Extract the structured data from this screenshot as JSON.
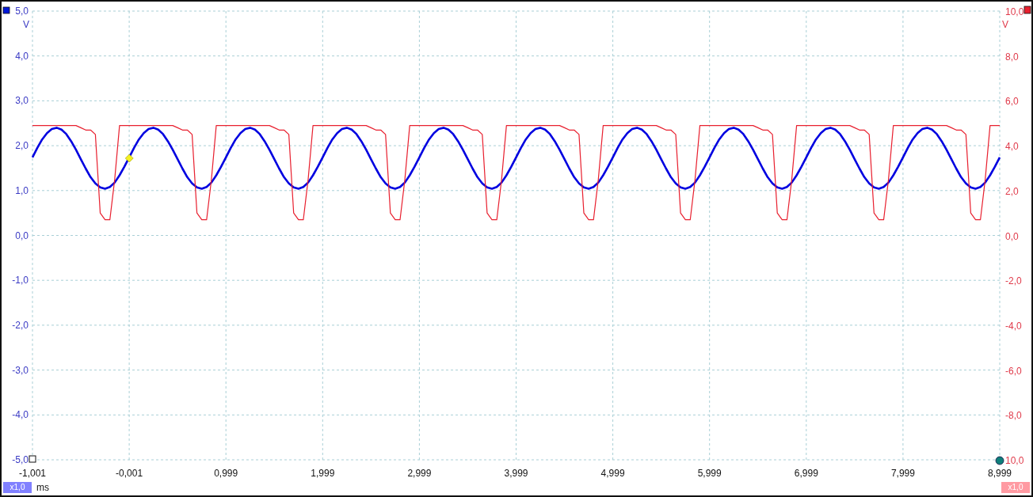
{
  "chart_data": {
    "type": "line",
    "grid": true,
    "xlabel": "ms",
    "ylabel": "V",
    "xlim": [
      -1.001,
      8.999
    ],
    "ylim": [
      -5,
      5
    ],
    "x": [
      -1.001,
      -0.951,
      -0.901,
      -0.851,
      -0.801,
      -0.751,
      -0.701,
      -0.651,
      -0.601,
      -0.551,
      -0.501,
      -0.451,
      -0.401,
      -0.351,
      -0.301,
      -0.251,
      -0.201,
      -0.151,
      -0.101,
      -0.051,
      -0.001,
      0.049,
      0.099,
      0.149,
      0.199,
      0.249,
      0.299,
      0.349,
      0.399,
      0.449,
      0.499,
      0.549,
      0.599,
      0.649,
      0.699,
      0.749,
      0.799,
      0.849,
      0.899,
      0.949,
      0.999,
      1.049,
      1.099,
      1.149,
      1.199,
      1.249,
      1.299,
      1.349,
      1.399,
      1.449,
      1.499,
      1.549,
      1.599,
      1.649,
      1.699,
      1.749,
      1.799,
      1.849,
      1.899,
      1.949,
      1.999,
      2.049,
      2.099,
      2.149,
      2.199,
      2.249,
      2.299,
      2.349,
      2.399,
      2.449,
      2.499,
      2.549,
      2.599,
      2.649,
      2.699,
      2.749,
      2.799,
      2.849,
      2.899,
      2.949,
      2.999,
      3.049,
      3.099,
      3.149,
      3.199,
      3.249,
      3.299,
      3.349,
      3.399,
      3.449,
      3.499,
      3.549,
      3.599,
      3.649,
      3.699,
      3.749,
      3.799,
      3.849,
      3.899,
      3.949,
      3.999,
      4.049,
      4.099,
      4.149,
      4.199,
      4.249,
      4.299,
      4.349,
      4.399,
      4.449,
      4.499,
      4.549,
      4.599,
      4.649,
      4.699,
      4.749,
      4.799,
      4.849,
      4.899,
      4.949,
      4.999,
      5.049,
      5.099,
      5.149,
      5.199,
      5.249,
      5.299,
      5.349,
      5.399,
      5.449,
      5.499,
      5.549,
      5.599,
      5.649,
      5.699,
      5.749,
      5.799,
      5.849,
      5.899,
      5.949,
      5.999,
      6.049,
      6.099,
      6.149,
      6.199,
      6.249,
      6.299,
      6.349,
      6.399,
      6.449,
      6.499,
      6.549,
      6.599,
      6.649,
      6.699,
      6.749,
      6.799,
      6.849,
      6.899,
      6.949,
      6.999,
      7.049,
      7.099,
      7.149,
      7.199,
      7.249,
      7.299,
      7.349,
      7.399,
      7.449,
      7.499,
      7.549,
      7.599,
      7.649,
      7.699,
      7.749,
      7.799,
      7.849,
      7.899,
      7.949,
      7.999,
      8.049,
      8.099,
      8.149,
      8.199,
      8.249,
      8.299,
      8.349,
      8.399,
      8.449,
      8.499,
      8.549,
      8.599,
      8.649,
      8.699,
      8.749,
      8.799,
      8.849,
      8.899,
      8.949,
      8.999
    ],
    "y2label": "V",
    "y2lim": [
      -10,
      10
    ],
    "y2ticks": [
      {
        "value": 10,
        "label": "10,0"
      },
      {
        "value": 8,
        "label": "8,0"
      },
      {
        "value": 6,
        "label": "6,0"
      },
      {
        "value": 4,
        "label": "4,0"
      },
      {
        "value": 2,
        "label": "2,0"
      },
      {
        "value": 0,
        "label": "0,0"
      },
      {
        "value": -2,
        "label": "-2,0"
      },
      {
        "value": -4,
        "label": "-4,0"
      },
      {
        "value": -6,
        "label": "-6,0"
      },
      {
        "value": -8,
        "label": "-8,0"
      },
      {
        "value": -10,
        "label": "10,0"
      }
    ],
    "xticks": [
      {
        "value": -1.001,
        "label": "-1,001"
      },
      {
        "value": -0.001,
        "label": "-0,001"
      },
      {
        "value": 0.999,
        "label": "0,999"
      },
      {
        "value": 1.999,
        "label": "1,999"
      },
      {
        "value": 2.999,
        "label": "2,999"
      },
      {
        "value": 3.999,
        "label": "3,999"
      },
      {
        "value": 4.999,
        "label": "4,999"
      },
      {
        "value": 5.999,
        "label": "5,999"
      },
      {
        "value": 6.999,
        "label": "6,999"
      },
      {
        "value": 7.999,
        "label": "7,999"
      },
      {
        "value": 8.999,
        "label": "8,999"
      }
    ],
    "yticks": [
      {
        "value": 5,
        "label": "5,0"
      },
      {
        "value": 4,
        "label": "4,0"
      },
      {
        "value": 3,
        "label": "3,0"
      },
      {
        "value": 2,
        "label": "2,0"
      },
      {
        "value": 1,
        "label": "1,0"
      },
      {
        "value": 0,
        "label": "0,0"
      },
      {
        "value": -1,
        "label": "-1,0"
      },
      {
        "value": -2,
        "label": "-2,0"
      },
      {
        "value": -3,
        "label": "-3,0"
      },
      {
        "value": -4,
        "label": "-4,0"
      },
      {
        "value": -5,
        "label": "-5,0"
      }
    ],
    "series": [
      {
        "color": "#0000e0",
        "values": [
          1.74,
          1.95,
          2.14,
          2.28,
          2.37,
          2.4,
          2.36,
          2.26,
          2.1,
          1.91,
          1.7,
          1.49,
          1.3,
          1.16,
          1.07,
          1.04,
          1.08,
          1.18,
          1.34,
          1.53,
          1.74,
          1.95,
          2.14,
          2.28,
          2.37,
          2.4,
          2.36,
          2.26,
          2.1,
          1.91,
          1.7,
          1.49,
          1.3,
          1.16,
          1.07,
          1.04,
          1.08,
          1.18,
          1.34,
          1.53,
          1.74,
          1.95,
          2.14,
          2.28,
          2.37,
          2.4,
          2.36,
          2.26,
          2.1,
          1.91,
          1.7,
          1.49,
          1.3,
          1.16,
          1.07,
          1.04,
          1.08,
          1.18,
          1.34,
          1.53,
          1.74,
          1.95,
          2.14,
          2.28,
          2.37,
          2.4,
          2.36,
          2.26,
          2.1,
          1.91,
          1.7,
          1.49,
          1.3,
          1.16,
          1.07,
          1.04,
          1.08,
          1.18,
          1.34,
          1.53,
          1.74,
          1.95,
          2.14,
          2.28,
          2.37,
          2.4,
          2.36,
          2.26,
          2.1,
          1.91,
          1.7,
          1.49,
          1.3,
          1.16,
          1.07,
          1.04,
          1.08,
          1.18,
          1.34,
          1.53,
          1.74,
          1.95,
          2.14,
          2.28,
          2.37,
          2.4,
          2.36,
          2.26,
          2.1,
          1.91,
          1.7,
          1.49,
          1.3,
          1.16,
          1.07,
          1.04,
          1.08,
          1.18,
          1.34,
          1.53,
          1.74,
          1.95,
          2.14,
          2.28,
          2.37,
          2.4,
          2.36,
          2.26,
          2.1,
          1.91,
          1.7,
          1.49,
          1.3,
          1.16,
          1.07,
          1.04,
          1.08,
          1.18,
          1.34,
          1.53,
          1.74,
          1.95,
          2.14,
          2.28,
          2.37,
          2.4,
          2.36,
          2.26,
          2.1,
          1.91,
          1.7,
          1.49,
          1.3,
          1.16,
          1.07,
          1.04,
          1.08,
          1.18,
          1.34,
          1.53,
          1.74,
          1.95,
          2.14,
          2.28,
          2.37,
          2.4,
          2.36,
          2.26,
          2.1,
          1.91,
          1.7,
          1.49,
          1.3,
          1.16,
          1.07,
          1.04,
          1.08,
          1.18,
          1.34,
          1.53,
          1.74,
          1.95,
          2.14,
          2.28,
          2.37,
          2.4,
          2.36,
          2.26,
          2.1,
          1.91,
          1.7,
          1.49,
          1.3,
          1.16,
          1.07,
          1.04,
          1.08,
          1.18,
          1.34,
          1.53,
          1.74
        ]
      },
      {
        "color": "#e8202f",
        "axis": "y2",
        "values": [
          4.9,
          4.9,
          4.9,
          4.9,
          4.9,
          4.9,
          4.9,
          4.9,
          4.9,
          4.9,
          4.8,
          4.7,
          4.7,
          4.5,
          1.0,
          0.7,
          0.7,
          2.5,
          4.9,
          4.9,
          4.9,
          4.9,
          4.9,
          4.9,
          4.9,
          4.9,
          4.9,
          4.9,
          4.9,
          4.9,
          4.8,
          4.7,
          4.7,
          4.5,
          1.0,
          0.7,
          0.7,
          2.5,
          4.9,
          4.9,
          4.9,
          4.9,
          4.9,
          4.9,
          4.9,
          4.9,
          4.9,
          4.9,
          4.9,
          4.9,
          4.8,
          4.7,
          4.7,
          4.5,
          1.0,
          0.7,
          0.7,
          2.5,
          4.9,
          4.9,
          4.9,
          4.9,
          4.9,
          4.9,
          4.9,
          4.9,
          4.9,
          4.9,
          4.9,
          4.9,
          4.8,
          4.7,
          4.7,
          4.5,
          1.0,
          0.7,
          0.7,
          2.5,
          4.9,
          4.9,
          4.9,
          4.9,
          4.9,
          4.9,
          4.9,
          4.9,
          4.9,
          4.9,
          4.9,
          4.9,
          4.8,
          4.7,
          4.7,
          4.5,
          1.0,
          0.7,
          0.7,
          2.5,
          4.9,
          4.9,
          4.9,
          4.9,
          4.9,
          4.9,
          4.9,
          4.9,
          4.9,
          4.9,
          4.9,
          4.9,
          4.8,
          4.7,
          4.7,
          4.5,
          1.0,
          0.7,
          0.7,
          2.5,
          4.9,
          4.9,
          4.9,
          4.9,
          4.9,
          4.9,
          4.9,
          4.9,
          4.9,
          4.9,
          4.9,
          4.9,
          4.8,
          4.7,
          4.7,
          4.5,
          1.0,
          0.7,
          0.7,
          2.5,
          4.9,
          4.9,
          4.9,
          4.9,
          4.9,
          4.9,
          4.9,
          4.9,
          4.9,
          4.9,
          4.9,
          4.9,
          4.8,
          4.7,
          4.7,
          4.5,
          1.0,
          0.7,
          0.7,
          2.5,
          4.9,
          4.9,
          4.9,
          4.9,
          4.9,
          4.9,
          4.9,
          4.9,
          4.9,
          4.9,
          4.9,
          4.9,
          4.8,
          4.7,
          4.7,
          4.5,
          1.0,
          0.7,
          0.7,
          2.5,
          4.9,
          4.9,
          4.9,
          4.9,
          4.9,
          4.9,
          4.9,
          4.9,
          4.9,
          4.9,
          4.9,
          4.9,
          4.8,
          4.7,
          4.7,
          4.5,
          1.0,
          0.7,
          0.7,
          2.5,
          4.9,
          4.9,
          4.9
        ]
      }
    ]
  },
  "left_scale": "x1,0",
  "right_scale": "x1,0"
}
